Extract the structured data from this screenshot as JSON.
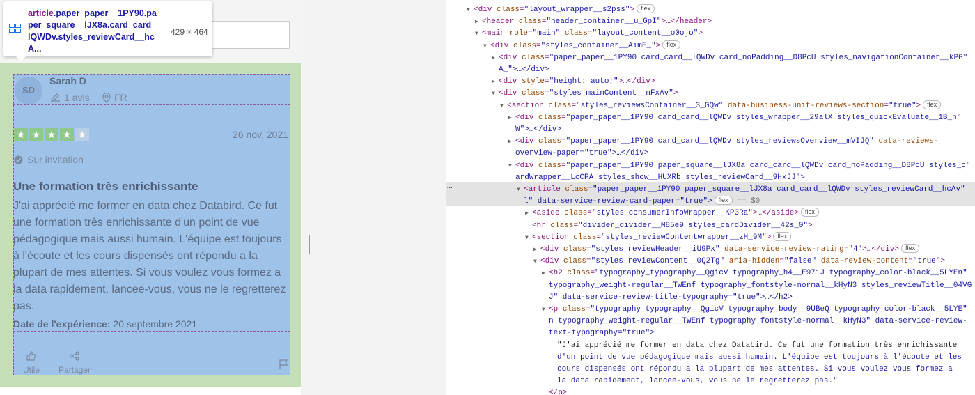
{
  "tooltip": {
    "selector_tag": "article",
    "selector_classes": ".paper_paper__1PY90.paper_square__lJX8a.card_card__lQWDv.styles_reviewCard__hcA...",
    "dimensions": "429 × 464"
  },
  "review": {
    "avatar_initials": "SD",
    "reviewer_name": "Sarah D",
    "review_count": "1 avis",
    "country": "FR",
    "rating": 4,
    "date": "26 nov. 2021",
    "invitation": "Sur invitation",
    "title": "Une formation très enrichissante",
    "text": "J'ai apprécié me former en data chez Databird. Ce fut une formation très enrichissante d'un point de vue pédagogique mais aussi humain. L'équipe est toujours à l'écoute et les cours dispensés ont répondu a la plupart de mes attentes. Si vous voulez vous formez a la data rapidement, lancee-vous, vous ne le regretterez pas.",
    "experience_label": "Date de l'expérience:",
    "experience_date": "20 septembre 2021",
    "useful_label": "Utile",
    "share_label": "Partager"
  },
  "colors": {
    "selection_fill": "#9fc2e8",
    "margin_fill": "#c4dfb7",
    "selected_row": "#e3e3e3"
  },
  "dom_tree": [
    {
      "indent": 0,
      "toggle": "open",
      "tag": "div",
      "attrs": [
        [
          "class",
          "layout_wrapper__s2pss"
        ]
      ],
      "suffix": ">",
      "badge": "flex"
    },
    {
      "indent": 1,
      "toggle": "closed",
      "tag": "header",
      "attrs": [
        [
          "class",
          "header_container__u_GpI"
        ]
      ],
      "suffix": ">…</header>"
    },
    {
      "indent": 1,
      "toggle": "open",
      "tag": "main",
      "attrs": [
        [
          "role",
          "main"
        ],
        [
          "class",
          "layout_content__o0ojo"
        ]
      ],
      "suffix": ">"
    },
    {
      "indent": 2,
      "toggle": "open",
      "tag": "div",
      "attrs": [
        [
          "class",
          "styles_container__AimE_"
        ]
      ],
      "suffix": ">",
      "badge": "flex"
    },
    {
      "indent": 3,
      "toggle": "closed",
      "tag": "div",
      "attrs": [
        [
          "class",
          "paper_paper__1PY90 card_card__lQWDv card_noPadding__D8PcU styles_navigationContainer__kPG"
        ]
      ],
      "suffix": ""
    },
    {
      "indent": 3,
      "toggle": "none",
      "raw": "A_\">…</div>"
    },
    {
      "indent": 3,
      "toggle": "closed",
      "tag": "div",
      "attrs": [
        [
          "style",
          "height: auto;"
        ]
      ],
      "suffix": ">…</div>"
    },
    {
      "indent": 3,
      "toggle": "open",
      "tag": "div",
      "attrs": [
        [
          "class",
          "styles_mainContent__nFxAv"
        ]
      ],
      "suffix": ">"
    },
    {
      "indent": 4,
      "toggle": "open",
      "tag": "section",
      "attrs": [
        [
          "class",
          "styles_reviewsContainer__3_GQw"
        ],
        [
          "data-business-unit-reviews-section",
          "true"
        ]
      ],
      "suffix": ">",
      "badge": "flex"
    },
    {
      "indent": 5,
      "toggle": "closed",
      "tag": "div",
      "attrs": [
        [
          "class",
          "paper_paper__1PY90 card_card__lQWDv styles_wrapper__29alX styles_quickEvaluate__1B_n"
        ]
      ],
      "suffix": ""
    },
    {
      "indent": 5,
      "toggle": "none",
      "raw": "W\">…</div>"
    },
    {
      "indent": 5,
      "toggle": "closed",
      "tag": "div",
      "attrs": [
        [
          "class",
          "paper_paper__1PY90 card_card__lQWDv styles_reviewsOverview__mVIJQ"
        ],
        [
          "data-reviews-"
        ]
      ],
      "suffix": ""
    },
    {
      "indent": 5,
      "toggle": "none",
      "raw": "overview-paper=\"true\">…</div>"
    },
    {
      "indent": 5,
      "toggle": "open",
      "tag": "div",
      "attrs": [
        [
          "class",
          "paper_paper__1PY90 paper_square__lJX8a card_card__lQWDv card_noPadding__D8PcU styles_c"
        ]
      ],
      "suffix": ""
    },
    {
      "indent": 5,
      "toggle": "none",
      "raw": "ardWrapper__LcCPA styles_show__HUXRb styles_reviewCard__9HxJJ\">"
    },
    {
      "indent": 6,
      "toggle": "open",
      "tag": "article",
      "attrs": [
        [
          "class",
          "paper_paper__1PY90 paper_square__lJX8a card_card__lQWDv styles_reviewCard__hcAv"
        ]
      ],
      "suffix": "",
      "selected": true
    },
    {
      "indent": 6,
      "toggle": "none",
      "raw": "l\" data-service-review-card-paper=\"true\">",
      "badge": "flex",
      "tail": " == $0",
      "selected": true
    },
    {
      "indent": 7,
      "toggle": "closed",
      "tag": "aside",
      "attrs": [
        [
          "class",
          "styles_consumerInfoWrapper__KP3Ra"
        ]
      ],
      "suffix": ">…</aside>",
      "badge": "flex"
    },
    {
      "indent": 7,
      "toggle": "none",
      "tag": "hr",
      "attrs": [
        [
          "class",
          "divider_divider__M85e9 styles_cardDivider__42s_0"
        ]
      ],
      "suffix": ">"
    },
    {
      "indent": 7,
      "toggle": "open",
      "tag": "section",
      "attrs": [
        [
          "class",
          "styles_reviewContentwrapper__zH_9M"
        ]
      ],
      "suffix": ">",
      "badge": "flex"
    },
    {
      "indent": 8,
      "toggle": "closed",
      "tag": "div",
      "attrs": [
        [
          "class",
          "styles_reviewHeader__iU9Px"
        ],
        [
          "data-service-review-rating",
          "4"
        ]
      ],
      "suffix": ">…</div>",
      "badge": "flex"
    },
    {
      "indent": 8,
      "toggle": "open",
      "tag": "div",
      "attrs": [
        [
          "class",
          "styles_reviewContent__0Q2Tg"
        ],
        [
          "aria-hidden",
          "false"
        ],
        [
          "data-review-content",
          "true"
        ]
      ],
      "suffix": ">"
    },
    {
      "indent": 9,
      "toggle": "closed",
      "tag": "h2",
      "attrs": [
        [
          "class",
          "typography_typography__QgicV typography_h4__E971J typography_color-black__5LYEn"
        ]
      ],
      "suffix": ""
    },
    {
      "indent": 9,
      "toggle": "none",
      "raw": "typography_weight-regular__TWEnf typography_fontstyle-normal__kHyN3 styles_reviewTitle__04VG"
    },
    {
      "indent": 9,
      "toggle": "none",
      "raw": "J\" data-service-review-title-typography=\"true\">…</h2>"
    },
    {
      "indent": 9,
      "toggle": "open",
      "tag": "p",
      "attrs": [
        [
          "class",
          "typography_typography__QgicV typography_body__9UBeQ typography_color-black__5LYE"
        ]
      ],
      "suffix": ""
    },
    {
      "indent": 9,
      "toggle": "none",
      "raw": "n typography_weight-regular__TWEnf typography_fontstyle-normal__kHyN3\" data-service-review-"
    },
    {
      "indent": 9,
      "toggle": "none",
      "raw": "text-typography=\"true\">"
    },
    {
      "indent": 10,
      "toggle": "none",
      "raw": "\"J'ai apprécié me former en data chez Databird. Ce fut une formation très enrichissante"
    },
    {
      "indent": 10,
      "toggle": "none",
      "raw": "d'un point de vue pédagogique mais aussi humain. L'équipe est toujours à l'écoute et les"
    },
    {
      "indent": 10,
      "toggle": "none",
      "raw": "cours dispensés ont répondu a la plupart de mes attentes. Si vous voulez vous formez a"
    },
    {
      "indent": 10,
      "toggle": "none",
      "raw": "la data rapidement, lancee-vous, vous ne le regretterez pas.\""
    },
    {
      "indent": 9,
      "toggle": "none",
      "raw": "</p>"
    }
  ]
}
